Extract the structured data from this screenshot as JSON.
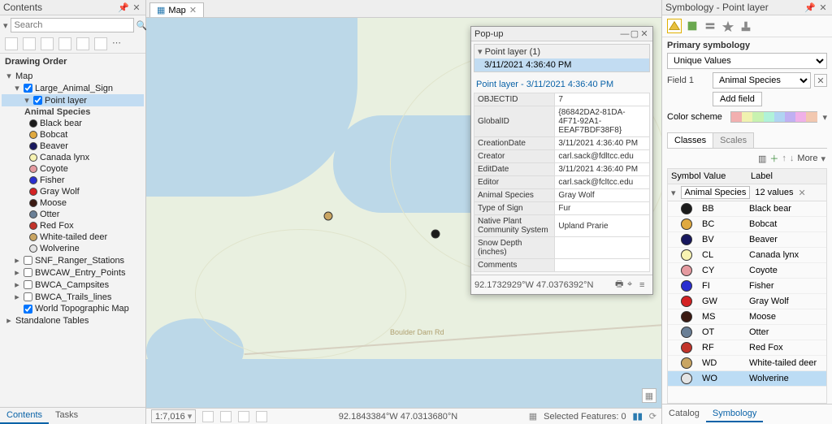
{
  "contents": {
    "title": "Contents",
    "search_placeholder": "Search",
    "drawing_order": "Drawing Order",
    "root": "Map",
    "layers": [
      {
        "name": "Large_Animal_Sign",
        "checked": true,
        "expanded": true
      },
      {
        "name": "SNF_Ranger_Stations",
        "checked": false
      },
      {
        "name": "BWCAW_Entry_Points",
        "checked": false
      },
      {
        "name": "BWCA_Campsites",
        "checked": false
      },
      {
        "name": "BWCA_Trails_lines",
        "checked": false
      },
      {
        "name": "World Topographic Map",
        "checked": true
      },
      {
        "name": "Standalone Tables",
        "checked": false,
        "notable": true
      }
    ],
    "point_layer_label": "Point layer",
    "category_heading": "Animal Species",
    "species": [
      {
        "label": "Black bear",
        "color": "#1b1b1b"
      },
      {
        "label": "Bobcat",
        "color": "#e0a93f"
      },
      {
        "label": "Beaver",
        "color": "#17175e"
      },
      {
        "label": "Canada lynx",
        "color": "#f7f3b2"
      },
      {
        "label": "Coyote",
        "color": "#e59aa0"
      },
      {
        "label": "Fisher",
        "color": "#2a2fd0"
      },
      {
        "label": "Gray Wolf",
        "color": "#d42223"
      },
      {
        "label": "Moose",
        "color": "#3b1a12"
      },
      {
        "label": "Otter",
        "color": "#6a7f96"
      },
      {
        "label": "Red Fox",
        "color": "#c2332a"
      },
      {
        "label": "White-tailed deer",
        "color": "#c9a562"
      },
      {
        "label": "Wolverine",
        "color": "#e4e4e4"
      }
    ],
    "tabs": [
      "Contents",
      "Tasks"
    ]
  },
  "map": {
    "tab_label": "Map",
    "scale": "1:7,016",
    "coord_bottom": "92.1843384°W 47.0313680°N",
    "selected_features": "Selected Features: 0"
  },
  "popup": {
    "title": "Pop-up",
    "list_header": "Point layer  (1)",
    "list_item": "3/11/2021 4:36:40 PM",
    "link": "Point layer - 3/11/2021 4:36:40 PM",
    "rows": [
      [
        "OBJECTID",
        "7"
      ],
      [
        "GlobalID",
        "{86842DA2-81DA-4F71-92A1-EEAF7BDF38F8}"
      ],
      [
        "CreationDate",
        "3/11/2021 4:36:40 PM"
      ],
      [
        "Creator",
        "carl.sack@fdltcc.edu"
      ],
      [
        "EditDate",
        "3/11/2021 4:36:40 PM"
      ],
      [
        "Editor",
        "carl.sack@fcltcc.edu"
      ],
      [
        "Animal Species",
        "Gray Wolf"
      ],
      [
        "Type of Sign",
        "Fur"
      ],
      [
        "Native Plant Community System",
        "Upland Prarie"
      ],
      [
        "Snow Depth (inches)",
        "<Null>"
      ],
      [
        "Comments",
        "<Null>"
      ]
    ],
    "footer_coord": "92.1732929°W 47.0376392°N"
  },
  "symb": {
    "title": "Symbology - Point layer",
    "primary": "Primary symbology",
    "method": "Unique Values",
    "field1_label": "Field 1",
    "field1_value": "Animal Species",
    "add_field": "Add field",
    "color_scheme_label": "Color scheme",
    "tabs": [
      "Classes",
      "Scales"
    ],
    "more": "More",
    "cols": [
      "Symbol",
      "Value",
      "Label"
    ],
    "group_name": "Animal Species",
    "group_count": "12 values",
    "rows": [
      {
        "v": "BB",
        "l": "Black bear",
        "c": "#1b1b1b"
      },
      {
        "v": "BC",
        "l": "Bobcat",
        "c": "#e0a93f"
      },
      {
        "v": "BV",
        "l": "Beaver",
        "c": "#17175e"
      },
      {
        "v": "CL",
        "l": "Canada lynx",
        "c": "#f7f3b2"
      },
      {
        "v": "CY",
        "l": "Coyote",
        "c": "#e59aa0"
      },
      {
        "v": "FI",
        "l": "Fisher",
        "c": "#2a2fd0"
      },
      {
        "v": "GW",
        "l": "Gray Wolf",
        "c": "#d42223"
      },
      {
        "v": "MS",
        "l": "Moose",
        "c": "#3b1a12"
      },
      {
        "v": "OT",
        "l": "Otter",
        "c": "#6a7f96"
      },
      {
        "v": "RF",
        "l": "Red Fox",
        "c": "#c2332a"
      },
      {
        "v": "WD",
        "l": "White-tailed deer",
        "c": "#c9a562"
      },
      {
        "v": "WO",
        "l": "Wolverine",
        "c": "#e4e4e4",
        "sel": true
      }
    ],
    "ramp": [
      "#f2b0b0",
      "#f0f2b0",
      "#c8f2b0",
      "#b0f2d9",
      "#b0d4f2",
      "#c0b0f2",
      "#f0b0e8",
      "#f2c8b0"
    ],
    "bottom_tabs": [
      "Catalog",
      "Symbology"
    ]
  }
}
